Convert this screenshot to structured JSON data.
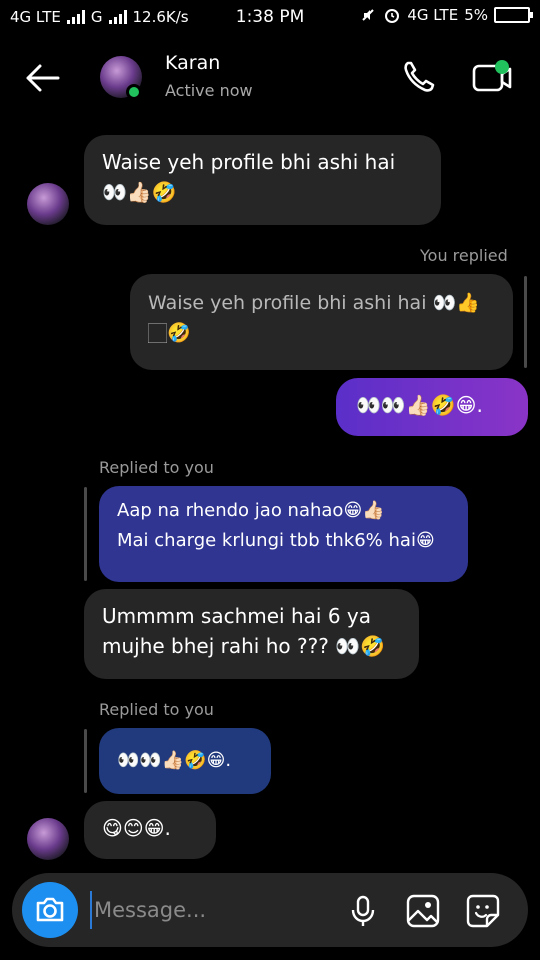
{
  "status_bar": {
    "network_left": "4G LTE",
    "network_mid": "G",
    "speed": "12.6K/s",
    "time": "1:38 PM",
    "network_right": "4G LTE",
    "battery": "5%"
  },
  "header": {
    "contact_name": "Karan",
    "contact_status": "Active now",
    "icons": [
      "back-arrow-icon",
      "phone-icon",
      "video-icon"
    ],
    "online_color": "#21c15d"
  },
  "messages": {
    "m1": {
      "line1": "Waise yeh profile bhi ashi hai",
      "line2": "👀👍🏻🤣"
    },
    "you_replied": "You replied",
    "m2_quote": {
      "line1": "Waise yeh profile bhi ashi hai 👀👍",
      "line2": "🏻🤣"
    },
    "m3": "👀👀👍🏻🤣😁.",
    "replied_to_you_1": "Replied to you",
    "m4": {
      "line1": "Aap na rhendo jao nahao😁👍🏻",
      "line2": "Mai charge krlungi tbb thk6% hai😁"
    },
    "m5": {
      "line1": "Ummmm sachmei hai 6 ya",
      "line2": "mujhe bhej rahi ho ??? 👀🤣"
    },
    "replied_to_you_2": "Replied to you",
    "m6": "👀👀👍🏻🤣😁.",
    "m7": "😋😊😁."
  },
  "composer": {
    "placeholder": "Message...",
    "icons": [
      "camera-icon",
      "microphone-icon",
      "image-icon",
      "sticker-icon"
    ]
  },
  "colors": {
    "background": "#000000",
    "incoming_bubble": "#262626",
    "outgoing_gradient": [
      "#5a2fc9",
      "#8a34c7"
    ],
    "camera_button": "#1d8ff0"
  }
}
